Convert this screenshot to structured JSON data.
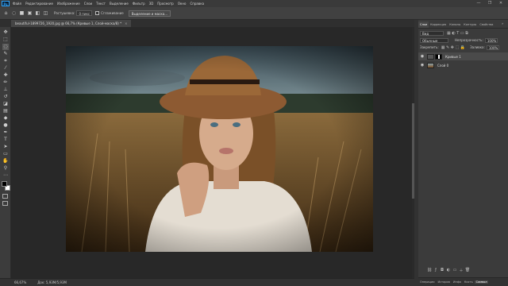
{
  "menu": {
    "logo": "Ps",
    "items": [
      "Файл",
      "Редактирование",
      "Изображение",
      "Слои",
      "Текст",
      "Выделение",
      "Фильтр",
      "3D",
      "Просмотр",
      "Окно",
      "Справка"
    ]
  },
  "window_controls": [
    "—",
    "❐",
    "✕"
  ],
  "options": {
    "feather_label": "Растушевка:",
    "feather_value": "0 пикс",
    "antialias_label": "Сглаживание",
    "select_mask_button": "Выделение и маска..."
  },
  "document_tab": {
    "title": "beautiful-1899726_1920.jpg @ 66,7% (Кривые 1, Слой-маска/8) *",
    "close": "×"
  },
  "status": {
    "zoom": "66,67%",
    "doc_size": "Док: 5,93М/5,93М"
  },
  "panel": {
    "tabs": [
      "Слои",
      "Коррекция",
      "Каналы",
      "Контуры",
      "Свойства"
    ],
    "active_tab": "Слои",
    "kind_filter": "Вид",
    "blend_mode": "Обычные",
    "opacity_label": "Непрозрачность:",
    "opacity_value": "100%",
    "lock_label": "Закрепить:",
    "fill_label": "Заливка:",
    "fill_value": "100%",
    "layers": [
      {
        "name": "Кривые 1",
        "selected": true
      },
      {
        "name": "Слой 0",
        "selected": false
      }
    ],
    "bottom_icons": [
      "link-icon",
      "fx-icon",
      "mask-icon",
      "adjustment-icon",
      "group-icon",
      "new-layer-icon",
      "trash-icon"
    ]
  },
  "bottom_tabs": [
    "Операции",
    "История",
    "Инфо",
    "Кисть",
    "Символ"
  ],
  "bottom_active": "Символ",
  "colors": {
    "accent": "#31a8ff",
    "foreground_color": "#000000",
    "background_color": "#ffffff"
  }
}
